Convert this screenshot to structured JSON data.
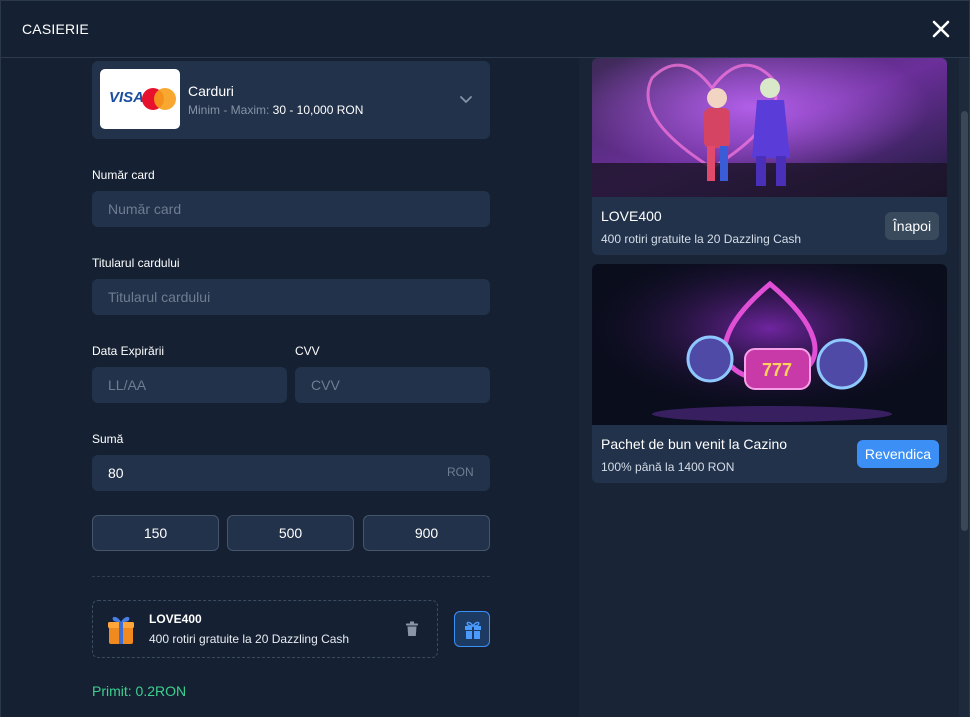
{
  "header": {
    "title": "CASIERIE",
    "close_icon": "close-icon"
  },
  "payment_method": {
    "logo_text": "VISA",
    "name": "Carduri",
    "limits_label": "Minim - Maxim:",
    "limits_value": "30 - 10,000 RON"
  },
  "form": {
    "card_number": {
      "label": "Număr card",
      "placeholder": "Număr card"
    },
    "card_holder": {
      "label": "Titularul cardului",
      "placeholder": "Titularul cardului"
    },
    "expiry": {
      "label": "Data Expirării",
      "placeholder": "LL/AA"
    },
    "cvv": {
      "label": "CVV",
      "placeholder": "CVV"
    },
    "amount": {
      "label": "Sumă",
      "value": "80",
      "currency": "RON"
    }
  },
  "quick_amounts": [
    "150",
    "500",
    "900"
  ],
  "applied_bonus": {
    "code": "LOVE400",
    "description": "400 rotiri gratuite la 20 Dazzling Cash"
  },
  "received": "Primit: 0.2RON",
  "promos": [
    {
      "title": "LOVE400",
      "description": "400 rotiri gratuite la 20 Dazzling Cash",
      "button": "Înapoi"
    },
    {
      "title": "Pachet de bun venit la Cazino",
      "description": "100% până la 1400 RON",
      "button": "Revendica"
    }
  ],
  "colors": {
    "accent": "#3b8ff5",
    "success": "#3ecf8e",
    "panel": "#22324a",
    "background": "#152132"
  }
}
